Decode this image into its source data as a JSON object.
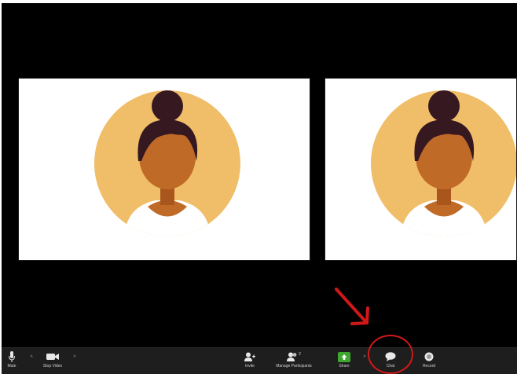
{
  "toolbar": {
    "mute_label": "Mute",
    "stop_video_label": "Stop Video",
    "invite_label": "Invite",
    "manage_participants_label": "Manage Participants",
    "participants_count": "2",
    "share_label": "Share",
    "chat_label": "Chat",
    "record_label": "Record"
  },
  "colors": {
    "background": "#000000",
    "toolbar": "#1e1e1e",
    "avatar_circle": "#f0bd68",
    "skin": "#c06a28",
    "hair": "#351820",
    "share_green": "#3ea82e",
    "annotation_red": "#d01818"
  },
  "icons": {
    "mute": "microphone-icon",
    "video": "video-camera-icon",
    "invite": "add-person-icon",
    "participants": "people-icon",
    "share": "share-screen-icon",
    "chat": "chat-bubble-icon",
    "record": "record-icon"
  }
}
